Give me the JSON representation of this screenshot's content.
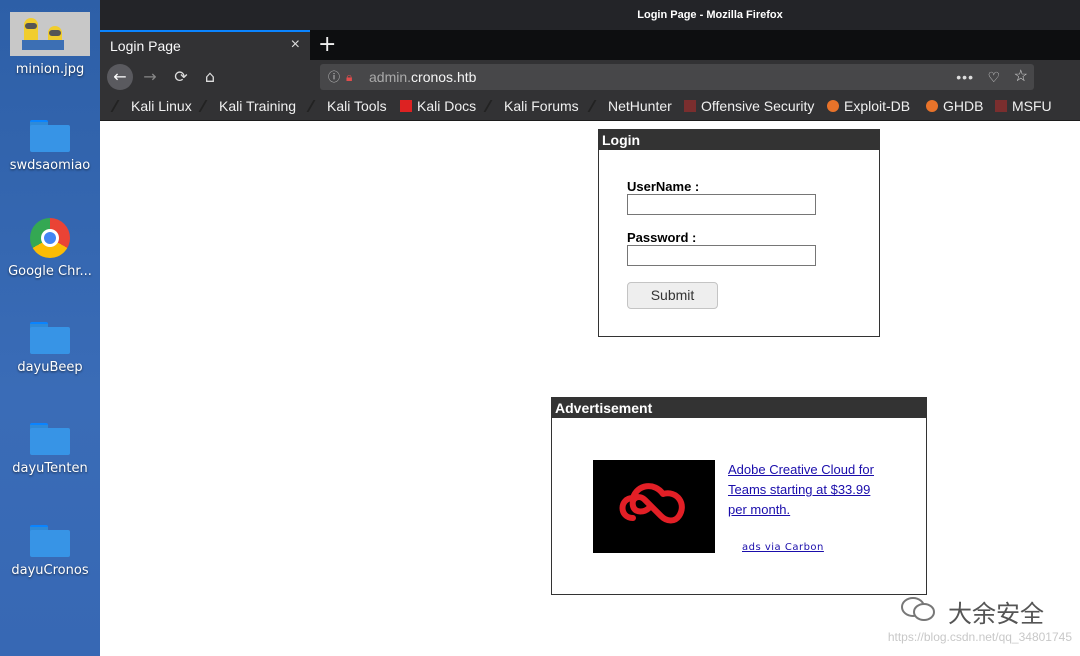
{
  "desktop": {
    "items": [
      {
        "label": "minion.jpg",
        "icon": "image-thumbnail-icon"
      },
      {
        "label": "swdsaomiao",
        "icon": "folder-icon"
      },
      {
        "label": "Google Chr...",
        "icon": "chrome-icon"
      },
      {
        "label": "dayuBeep",
        "icon": "folder-icon"
      },
      {
        "label": "dayuTenten",
        "icon": "folder-icon"
      },
      {
        "label": "dayuCronos",
        "icon": "folder-icon"
      }
    ]
  },
  "window": {
    "title": "Login Page - Mozilla Firefox"
  },
  "tabs": [
    {
      "label": "Login Page",
      "close": "×"
    }
  ],
  "newtab": "+",
  "nav": {
    "back": "←",
    "forward": "→",
    "reload": "⟳",
    "home": "⌂"
  },
  "urlbar": {
    "prefix": "admin.",
    "domain": "cronos.htb",
    "more": "•••"
  },
  "bookmarks": [
    {
      "label": "Kali Linux",
      "color": "#1d1d1d"
    },
    {
      "label": "Kali Training",
      "color": "#1d1d1d"
    },
    {
      "label": "Kali Tools",
      "color": "#1d1d1d"
    },
    {
      "label": "Kali Docs",
      "color": "#d22"
    },
    {
      "label": "Kali Forums",
      "color": "#1d1d1d"
    },
    {
      "label": "NetHunter",
      "color": "#1d1d1d"
    },
    {
      "label": "Offensive Security",
      "color": "#7a2e2e"
    },
    {
      "label": "Exploit-DB",
      "color": "#e8732a"
    },
    {
      "label": "GHDB",
      "color": "#e8732a"
    },
    {
      "label": "MSFU",
      "color": "#7a2e2e"
    }
  ],
  "login": {
    "header": "Login",
    "username_label": "UserName :",
    "password_label": "Password :",
    "submit": "Submit"
  },
  "ad": {
    "header": "Advertisement",
    "link": "Adobe Creative Cloud for Teams starting at $33.99 per month.",
    "credit": "ads via Carbon",
    "logo_color": "#e21f26"
  },
  "watermark": {
    "text": "大余安全",
    "url": "https://blog.csdn.net/qq_34801745"
  }
}
